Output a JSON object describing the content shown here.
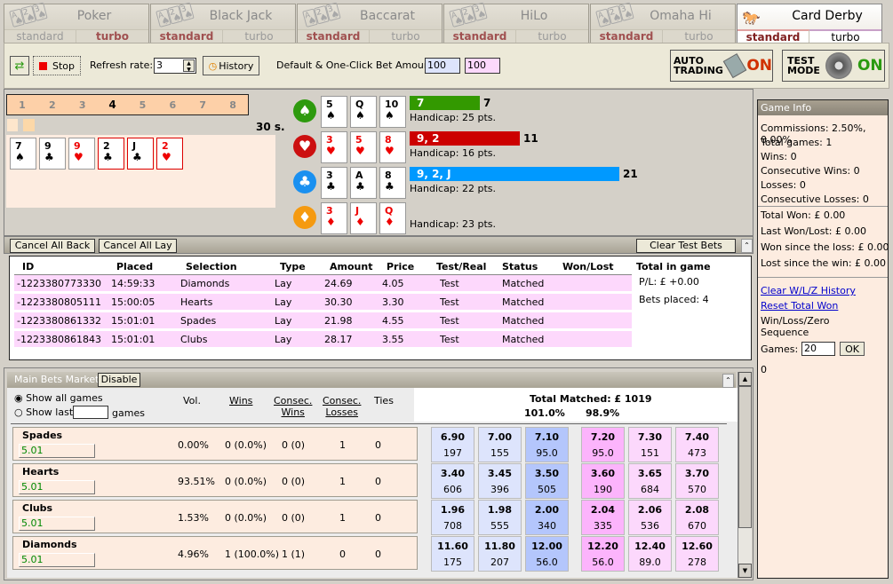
{
  "tabs": [
    {
      "name": "Poker",
      "standard": "standard",
      "turbo": "turbo",
      "active_variant": "turbo"
    },
    {
      "name": "Black Jack",
      "standard": "standard",
      "turbo": "turbo",
      "active_variant": "standard"
    },
    {
      "name": "Baccarat",
      "standard": "standard",
      "turbo": "turbo",
      "active_variant": "standard"
    },
    {
      "name": "HiLo",
      "standard": "standard",
      "turbo": "turbo",
      "active_variant": "standard"
    },
    {
      "name": "Omaha Hi",
      "standard": "standard",
      "turbo": "turbo",
      "active_variant": "standard"
    },
    {
      "name": "Card Derby",
      "standard": "standard",
      "turbo": "turbo",
      "active_variant": "standard",
      "current": true
    }
  ],
  "toolbar": {
    "stop_label": "Stop",
    "refresh_label": "Refresh rate:",
    "refresh_value": "3",
    "history_label": "History",
    "bet_amounts_label": "Default & One-Click Bet Amounts:",
    "default_amount": "100",
    "oneclick_amount": "100",
    "auto_trading_label_1": "AUTO",
    "auto_trading_label_2": "TRADING",
    "auto_trading_state": "ON",
    "test_mode_label_1": "TEST",
    "test_mode_label_2": "MODE",
    "test_mode_state": "ON"
  },
  "game": {
    "rounds": [
      "1",
      "2",
      "3",
      "4",
      "5",
      "6",
      "7",
      "8"
    ],
    "current_round": "4",
    "timer": "30 s.",
    "dealt_cards": [
      {
        "rank": "7",
        "suit": "♠",
        "color": "black",
        "highlight": false
      },
      {
        "rank": "9",
        "suit": "♣",
        "color": "black",
        "highlight": false
      },
      {
        "rank": "9",
        "suit": "♥",
        "color": "red",
        "highlight": false
      },
      {
        "rank": "2",
        "suit": "♣",
        "color": "black",
        "highlight": true
      },
      {
        "rank": "J",
        "suit": "♣",
        "color": "black",
        "highlight": true
      },
      {
        "rank": "2",
        "suit": "♥",
        "color": "red",
        "highlight": true
      }
    ],
    "horses": [
      {
        "suit_icon": "spade-icon",
        "glyph": "♠",
        "icon_color": "#2e9a0e",
        "cards": [
          {
            "rank": "5",
            "suit": "♠",
            "color": "black"
          },
          {
            "rank": "Q",
            "suit": "♠",
            "color": "black"
          },
          {
            "rank": "10",
            "suit": "♠",
            "color": "black"
          }
        ],
        "bar_label": "7",
        "bar_value": "7",
        "progress": 7,
        "bar_color": "#339900",
        "handicap": "Handicap: 25 pts."
      },
      {
        "suit_icon": "heart-icon",
        "glyph": "♥",
        "icon_color": "#cc1010",
        "cards": [
          {
            "rank": "3",
            "suit": "♥",
            "color": "red"
          },
          {
            "rank": "5",
            "suit": "♥",
            "color": "red"
          },
          {
            "rank": "8",
            "suit": "♥",
            "color": "red"
          }
        ],
        "bar_label": "9, 2",
        "bar_value": "11",
        "progress": 11,
        "bar_color": "#cc0000",
        "handicap": "Handicap: 16 pts."
      },
      {
        "suit_icon": "club-icon",
        "glyph": "♣",
        "icon_color": "#1a90f0",
        "cards": [
          {
            "rank": "3",
            "suit": "♣",
            "color": "black"
          },
          {
            "rank": "A",
            "suit": "♣",
            "color": "black"
          },
          {
            "rank": "8",
            "suit": "♣",
            "color": "black"
          }
        ],
        "bar_label": "9, 2, J",
        "bar_value": "21",
        "progress": 21,
        "bar_color": "#0099ff",
        "handicap": "Handicap: 22 pts."
      },
      {
        "suit_icon": "diamond-icon",
        "glyph": "♦",
        "icon_color": "#f59a10",
        "cards": [
          {
            "rank": "3",
            "suit": "♦",
            "color": "red"
          },
          {
            "rank": "J",
            "suit": "♦",
            "color": "red"
          },
          {
            "rank": "Q",
            "suit": "♦",
            "color": "red"
          }
        ],
        "bar_label": "",
        "bar_value": "",
        "progress": 0,
        "bar_color": "#f59a10",
        "handicap": "Handicap: 23 pts."
      }
    ]
  },
  "bets": {
    "cancel_back": "Cancel All Back",
    "cancel_lay": "Cancel All Lay",
    "clear_test": "Clear Test Bets",
    "headers": [
      "ID",
      "Placed",
      "Selection",
      "Type",
      "Amount",
      "Price",
      "Test/Real",
      "Status",
      "Won/Lost"
    ],
    "rows": [
      [
        "-1223380773330",
        "14:59:33",
        "Diamonds",
        "Lay",
        "24.69",
        "4.05",
        "Test",
        "Matched",
        ""
      ],
      [
        "-1223380805111",
        "15:00:05",
        "Hearts",
        "Lay",
        "30.30",
        "3.30",
        "Test",
        "Matched",
        ""
      ],
      [
        "-1223380861332",
        "15:01:01",
        "Spades",
        "Lay",
        "21.98",
        "4.55",
        "Test",
        "Matched",
        ""
      ],
      [
        "-1223380861843",
        "15:01:01",
        "Clubs",
        "Lay",
        "28.17",
        "3.55",
        "Test",
        "Matched",
        ""
      ]
    ],
    "total_title": "Total in game",
    "pl": "P/L: £ +0.00",
    "bets_placed": "Bets placed: 4"
  },
  "market": {
    "title": "Main Bets Market",
    "disable_label": "Disable",
    "show_all": "Show all games",
    "show_last": "Show last",
    "games_label": "games",
    "col_vol": "Vol.",
    "col_wins": "Wins",
    "col_consec_wins_1": "Consec.",
    "col_consec_wins_2": "Wins",
    "col_consec_losses_1": "Consec.",
    "col_consec_losses_2": "Losses",
    "col_ties": "Ties",
    "total_matched": "Total Matched: £ 1019",
    "back_pct": "101.0%",
    "lay_pct": "98.9%",
    "rows": [
      {
        "name": "Spades",
        "value": "5.01",
        "vol": "0.00%",
        "wins": "0 (0.0%)",
        "consec_wins": "0 (0)",
        "consec_losses": "1",
        "ties": "0",
        "back": [
          {
            "p": "6.90",
            "a": "197"
          },
          {
            "p": "7.00",
            "a": "155"
          },
          {
            "p": "7.10",
            "a": "95.0"
          }
        ],
        "lay": [
          {
            "p": "7.20",
            "a": "95.0"
          },
          {
            "p": "7.30",
            "a": "151"
          },
          {
            "p": "7.40",
            "a": "473"
          }
        ]
      },
      {
        "name": "Hearts",
        "value": "5.01",
        "vol": "93.51%",
        "wins": "0 (0.0%)",
        "consec_wins": "0 (0)",
        "consec_losses": "1",
        "ties": "0",
        "back": [
          {
            "p": "3.40",
            "a": "606"
          },
          {
            "p": "3.45",
            "a": "396"
          },
          {
            "p": "3.50",
            "a": "505"
          }
        ],
        "lay": [
          {
            "p": "3.60",
            "a": "190"
          },
          {
            "p": "3.65",
            "a": "684"
          },
          {
            "p": "3.70",
            "a": "570"
          }
        ]
      },
      {
        "name": "Clubs",
        "value": "5.01",
        "vol": "1.53%",
        "wins": "0 (0.0%)",
        "consec_wins": "0 (0)",
        "consec_losses": "1",
        "ties": "0",
        "back": [
          {
            "p": "1.96",
            "a": "708"
          },
          {
            "p": "1.98",
            "a": "555"
          },
          {
            "p": "2.00",
            "a": "340"
          }
        ],
        "lay": [
          {
            "p": "2.04",
            "a": "335"
          },
          {
            "p": "2.06",
            "a": "536"
          },
          {
            "p": "2.08",
            "a": "670"
          }
        ]
      },
      {
        "name": "Diamonds",
        "value": "5.01",
        "vol": "4.96%",
        "wins": "1 (100.0%)",
        "consec_wins": "1 (1)",
        "consec_losses": "0",
        "ties": "0",
        "back": [
          {
            "p": "11.60",
            "a": "175"
          },
          {
            "p": "11.80",
            "a": "207"
          },
          {
            "p": "12.00",
            "a": "56.0"
          }
        ],
        "lay": [
          {
            "p": "12.20",
            "a": "56.0"
          },
          {
            "p": "12.40",
            "a": "89.0"
          },
          {
            "p": "12.60",
            "a": "278"
          }
        ]
      }
    ]
  },
  "info": {
    "title": "Game Info",
    "lines1": [
      "Commissions: 2.50%, 0.00%",
      "Total games: 1",
      "Wins: 0",
      "Consecutive Wins: 0",
      "Losses: 0",
      "Consecutive Losses: 0"
    ],
    "lines2": [
      "Total Won: £ 0.00",
      "Last Won/Lost: £ 0.00",
      "Won since the loss: £ 0.00",
      "Lost since the win: £ 0.00"
    ],
    "clear_history": "Clear W/L/Z History",
    "reset_total": "Reset Total Won",
    "sequence_1": "Win/Loss/Zero",
    "sequence_2": "Sequence",
    "games_label": "Games:",
    "games_value": "20",
    "ok_label": "OK",
    "sequence_value": "0"
  }
}
